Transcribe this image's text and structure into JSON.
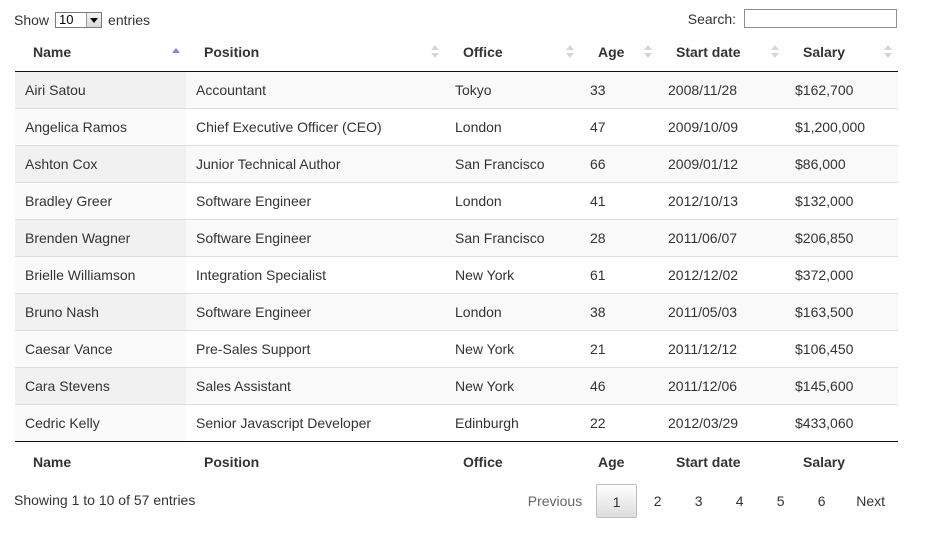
{
  "length_control": {
    "show_label": "Show",
    "selected": "10",
    "entries_label": "entries"
  },
  "search": {
    "label": "Search:",
    "value": ""
  },
  "columns": [
    "Name",
    "Position",
    "Office",
    "Age",
    "Start date",
    "Salary"
  ],
  "sort": {
    "column": "Name",
    "direction": "ascending"
  },
  "rows": [
    [
      "Airi Satou",
      "Accountant",
      "Tokyo",
      "33",
      "2008/11/28",
      "$162,700"
    ],
    [
      "Angelica Ramos",
      "Chief Executive Officer (CEO)",
      "London",
      "47",
      "2009/10/09",
      "$1,200,000"
    ],
    [
      "Ashton Cox",
      "Junior Technical Author",
      "San Francisco",
      "66",
      "2009/01/12",
      "$86,000"
    ],
    [
      "Bradley Greer",
      "Software Engineer",
      "London",
      "41",
      "2012/10/13",
      "$132,000"
    ],
    [
      "Brenden Wagner",
      "Software Engineer",
      "San Francisco",
      "28",
      "2011/06/07",
      "$206,850"
    ],
    [
      "Brielle Williamson",
      "Integration Specialist",
      "New York",
      "61",
      "2012/12/02",
      "$372,000"
    ],
    [
      "Bruno Nash",
      "Software Engineer",
      "London",
      "38",
      "2011/05/03",
      "$163,500"
    ],
    [
      "Caesar Vance",
      "Pre-Sales Support",
      "New York",
      "21",
      "2011/12/12",
      "$106,450"
    ],
    [
      "Cara Stevens",
      "Sales Assistant",
      "New York",
      "46",
      "2011/12/06",
      "$145,600"
    ],
    [
      "Cedric Kelly",
      "Senior Javascript Developer",
      "Edinburgh",
      "22",
      "2012/03/29",
      "$433,060"
    ]
  ],
  "info": "Showing 1 to 10 of 57 entries",
  "pagination": {
    "previous": "Previous",
    "next": "Next",
    "pages": [
      "1",
      "2",
      "3",
      "4",
      "5",
      "6"
    ],
    "current": "1"
  },
  "colors": {
    "sort_active": "#7c88d8",
    "sort_inactive": "#d6d6d6",
    "row_stripe": "#f9f9f9",
    "header_rule": "#111111"
  }
}
